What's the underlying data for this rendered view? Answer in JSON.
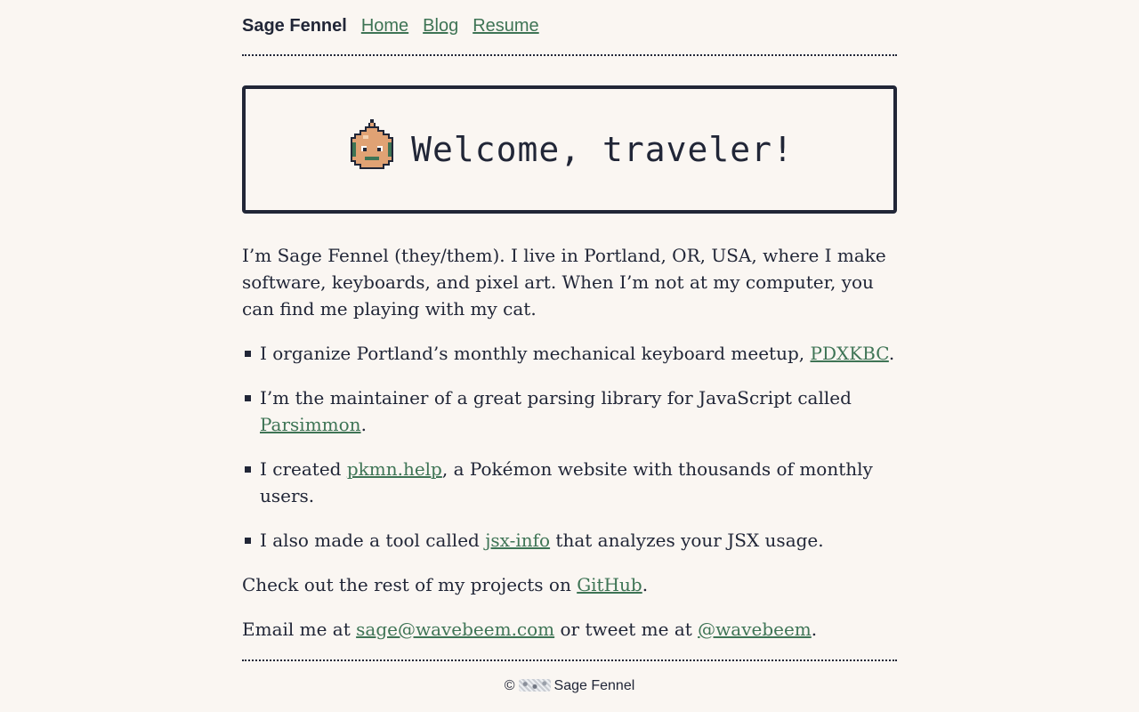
{
  "header": {
    "brand": "Sage Fennel",
    "nav": [
      {
        "label": "Home"
      },
      {
        "label": "Blog"
      },
      {
        "label": "Resume"
      }
    ]
  },
  "banner": {
    "title": "Welcome, traveler!",
    "icon": "onion-slime-icon"
  },
  "intro": {
    "text": "I’m Sage Fennel (they/them). I live in Portland, OR, USA, where I make software, keyboards, and pixel art. When I’m not at my computer, you can find me playing with my cat."
  },
  "list": [
    {
      "before": "I organize Portland’s monthly mechanical keyboard meetup, ",
      "link": "PDXKBC",
      "after": "."
    },
    {
      "before": "I’m the maintainer of a great parsing library for JavaScript called ",
      "link": "Parsimmon",
      "after": "."
    },
    {
      "before": "I created ",
      "link": "pkmn.help",
      "after": ", a Pokémon website with thousands of monthly users."
    },
    {
      "before": "I also made a tool called ",
      "link": "jsx-info",
      "after": " that analyzes your JSX usage."
    }
  ],
  "projects": {
    "before": "Check out the rest of my projects on ",
    "link": "GitHub",
    "after": "."
  },
  "contact": {
    "before": "Email me at ",
    "email": "sage@wavebeem.com",
    "middle": " or tweet me at ",
    "twitter": "@wavebeem",
    "after": "."
  },
  "footer": {
    "copyright": "©",
    "name": "Sage Fennel"
  },
  "colors": {
    "background": "#faf6f2",
    "text": "#212637",
    "link": "#3e7455",
    "onion": "#e0a274"
  }
}
